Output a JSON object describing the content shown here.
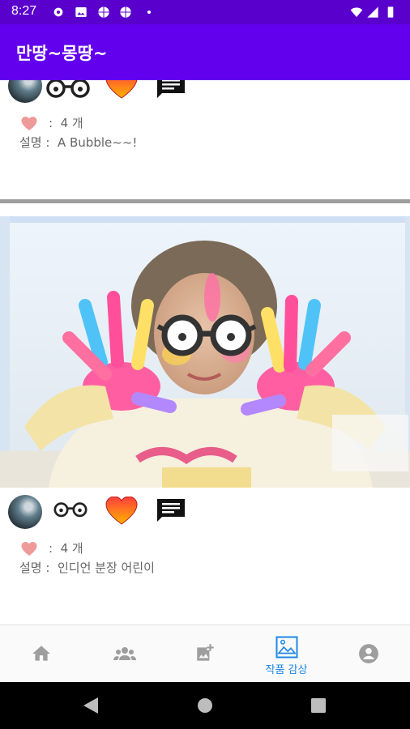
{
  "status_bar": {
    "time": "8:27",
    "icons": [
      "gear-icon",
      "gallery-icon",
      "basketball-icon",
      "basketball-icon",
      "dot-icon",
      "wifi-icon",
      "signal-icon",
      "battery-icon"
    ]
  },
  "app_bar": {
    "title": "만땅~몽땅~"
  },
  "posts": [
    {
      "likes_label": "4 개",
      "like_sep": ":",
      "desc_prefix": "설명 :",
      "description": "A Bubble~~!"
    },
    {
      "likes_label": "4 개",
      "like_sep": ":",
      "desc_prefix": "설명 :",
      "description": "인디언 분장 어린이"
    }
  ],
  "bottom_nav": {
    "items": [
      {
        "icon": "home-icon",
        "label": ""
      },
      {
        "icon": "people-icon",
        "label": ""
      },
      {
        "icon": "add-photo-icon",
        "label": ""
      },
      {
        "icon": "gallery-icon",
        "label": "작품 감상"
      },
      {
        "icon": "account-icon",
        "label": ""
      }
    ]
  },
  "colors": {
    "status_bar": "#5a00cc",
    "app_bar": "#6200ee",
    "accent": "#1e88e5"
  }
}
